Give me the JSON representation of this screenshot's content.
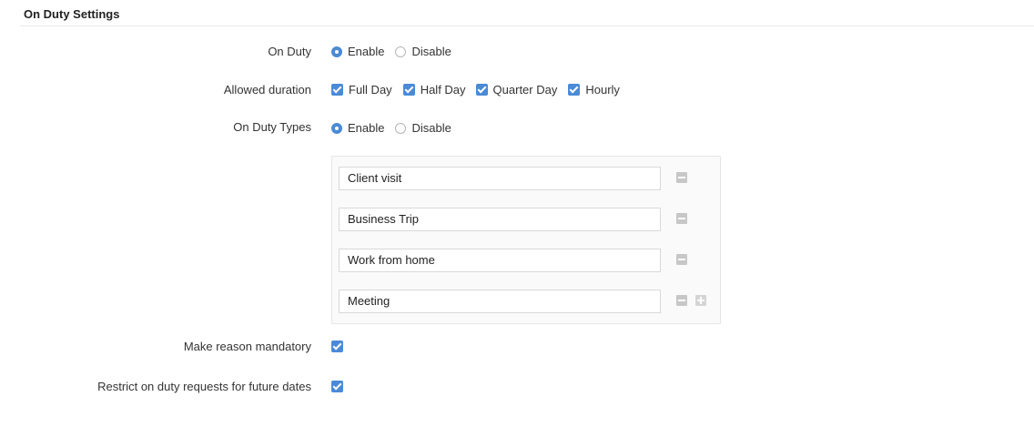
{
  "section": {
    "title": "On Duty Settings"
  },
  "on_duty": {
    "label": "On Duty",
    "options": [
      {
        "label": "Enable",
        "selected": true
      },
      {
        "label": "Disable",
        "selected": false
      }
    ]
  },
  "allowed_duration": {
    "label": "Allowed duration",
    "options": [
      {
        "label": "Full Day",
        "checked": true
      },
      {
        "label": "Half Day",
        "checked": true
      },
      {
        "label": "Quarter Day",
        "checked": true
      },
      {
        "label": "Hourly",
        "checked": true
      }
    ]
  },
  "on_duty_types": {
    "label": "On Duty Types",
    "options": [
      {
        "label": "Enable",
        "selected": true
      },
      {
        "label": "Disable",
        "selected": false
      }
    ],
    "types": [
      "Client visit",
      "Business Trip",
      "Work from home",
      "Meeting"
    ]
  },
  "reason_mandatory": {
    "label": "Make reason mandatory",
    "checked": true
  },
  "restrict_future": {
    "label": "Restrict on duty requests for future dates",
    "checked": true
  },
  "colors": {
    "accent": "#4a8ad6",
    "icon_gray": "#c7c7c7"
  }
}
